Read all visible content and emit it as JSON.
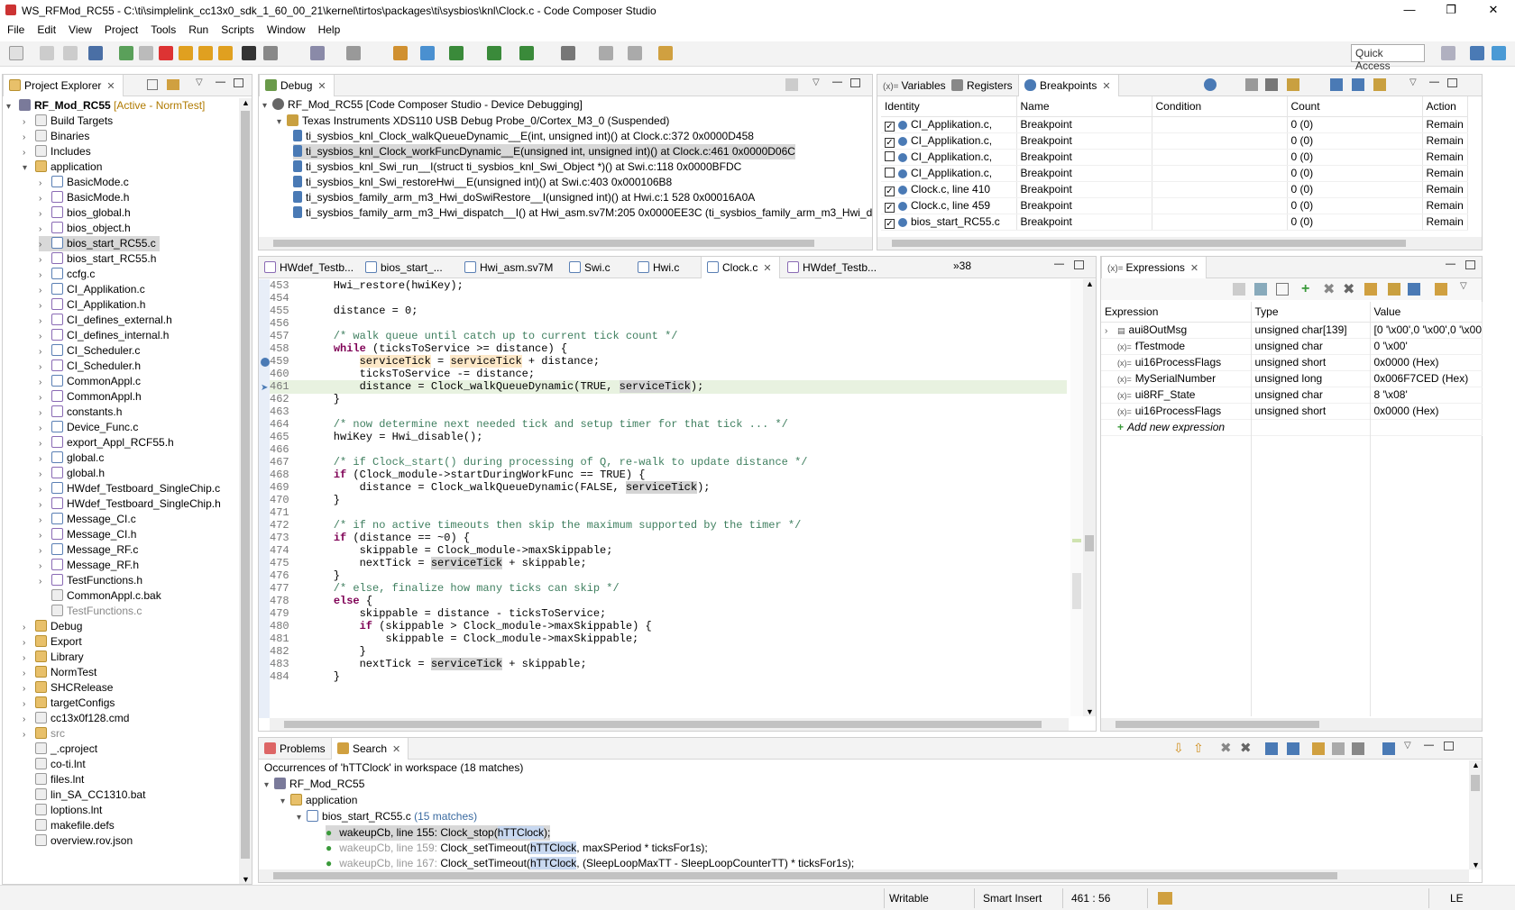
{
  "window": {
    "title": "WS_RFMod_RC55 - C:\\ti\\simplelink_cc13x0_sdk_1_60_00_21\\kernel\\tirtos\\packages\\ti\\sysbios\\knl\\Clock.c - Code Composer Studio"
  },
  "menu": [
    "File",
    "Edit",
    "View",
    "Project",
    "Tools",
    "Run",
    "Scripts",
    "Window",
    "Help"
  ],
  "quick_access": "Quick Access",
  "project_explorer": {
    "tab": "Project Explorer",
    "project": "RF_Mod_RC55",
    "project_status": "[Active - NormTest]",
    "items": [
      {
        "label": "Build Targets",
        "depth": 1,
        "kind": "target"
      },
      {
        "label": "Binaries",
        "depth": 1,
        "kind": "bin"
      },
      {
        "label": "Includes",
        "depth": 1,
        "kind": "inc"
      },
      {
        "label": "application",
        "depth": 1,
        "kind": "folder",
        "open": true
      },
      {
        "label": "BasicMode.c",
        "depth": 2,
        "kind": "c"
      },
      {
        "label": "BasicMode.h",
        "depth": 2,
        "kind": "h"
      },
      {
        "label": "bios_global.h",
        "depth": 2,
        "kind": "h"
      },
      {
        "label": "bios_object.h",
        "depth": 2,
        "kind": "h"
      },
      {
        "label": "bios_start_RC55.c",
        "depth": 2,
        "kind": "c",
        "selected": true
      },
      {
        "label": "bios_start_RC55.h",
        "depth": 2,
        "kind": "h"
      },
      {
        "label": "ccfg.c",
        "depth": 2,
        "kind": "c"
      },
      {
        "label": "CI_Applikation.c",
        "depth": 2,
        "kind": "c"
      },
      {
        "label": "CI_Applikation.h",
        "depth": 2,
        "kind": "h"
      },
      {
        "label": "CI_defines_external.h",
        "depth": 2,
        "kind": "h"
      },
      {
        "label": "CI_defines_internal.h",
        "depth": 2,
        "kind": "h"
      },
      {
        "label": "CI_Scheduler.c",
        "depth": 2,
        "kind": "c"
      },
      {
        "label": "CI_Scheduler.h",
        "depth": 2,
        "kind": "h"
      },
      {
        "label": "CommonAppl.c",
        "depth": 2,
        "kind": "c"
      },
      {
        "label": "CommonAppl.h",
        "depth": 2,
        "kind": "h"
      },
      {
        "label": "constants.h",
        "depth": 2,
        "kind": "h"
      },
      {
        "label": "Device_Func.c",
        "depth": 2,
        "kind": "c"
      },
      {
        "label": "export_Appl_RCF55.h",
        "depth": 2,
        "kind": "h"
      },
      {
        "label": "global.c",
        "depth": 2,
        "kind": "c"
      },
      {
        "label": "global.h",
        "depth": 2,
        "kind": "h"
      },
      {
        "label": "HWdef_Testboard_SingleChip.c",
        "depth": 2,
        "kind": "c"
      },
      {
        "label": "HWdef_Testboard_SingleChip.h",
        "depth": 2,
        "kind": "h"
      },
      {
        "label": "Message_CI.c",
        "depth": 2,
        "kind": "c"
      },
      {
        "label": "Message_CI.h",
        "depth": 2,
        "kind": "h"
      },
      {
        "label": "Message_RF.c",
        "depth": 2,
        "kind": "c"
      },
      {
        "label": "Message_RF.h",
        "depth": 2,
        "kind": "h"
      },
      {
        "label": "TestFunctions.h",
        "depth": 2,
        "kind": "h"
      },
      {
        "label": "CommonAppl.c.bak",
        "depth": 2,
        "kind": "file",
        "noarrow": true
      },
      {
        "label": "TestFunctions.c",
        "depth": 2,
        "kind": "file",
        "noarrow": true,
        "grey": true
      },
      {
        "label": "Debug",
        "depth": 1,
        "kind": "folder"
      },
      {
        "label": "Export",
        "depth": 1,
        "kind": "folder"
      },
      {
        "label": "Library",
        "depth": 1,
        "kind": "folder"
      },
      {
        "label": "NormTest",
        "depth": 1,
        "kind": "folder"
      },
      {
        "label": "SHCRelease",
        "depth": 1,
        "kind": "folder"
      },
      {
        "label": "targetConfigs",
        "depth": 1,
        "kind": "folder"
      },
      {
        "label": "cc13x0f128.cmd",
        "depth": 1,
        "kind": "file"
      },
      {
        "label": "src",
        "depth": 1,
        "kind": "folder",
        "grey": true
      },
      {
        "label": "_.cproject",
        "depth": 1,
        "kind": "file",
        "noarrow": true
      },
      {
        "label": "co-ti.lnt",
        "depth": 1,
        "kind": "file",
        "noarrow": true
      },
      {
        "label": "files.lnt",
        "depth": 1,
        "kind": "file",
        "noarrow": true
      },
      {
        "label": "lin_SA_CC1310.bat",
        "depth": 1,
        "kind": "file",
        "noarrow": true
      },
      {
        "label": "loptions.lnt",
        "depth": 1,
        "kind": "file",
        "noarrow": true
      },
      {
        "label": "makefile.defs",
        "depth": 1,
        "kind": "file",
        "noarrow": true
      },
      {
        "label": "overview.rov.json",
        "depth": 1,
        "kind": "file",
        "noarrow": true
      }
    ]
  },
  "debug": {
    "tab": "Debug",
    "session": "RF_Mod_RC55 [Code Composer Studio - Device Debugging]",
    "probe": "Texas Instruments XDS110 USB Debug Probe_0/Cortex_M3_0 (Suspended)",
    "frames": [
      "ti_sysbios_knl_Clock_walkQueueDynamic__E(int, unsigned int)() at Clock.c:372 0x0000D458",
      "ti_sysbios_knl_Clock_workFuncDynamic__E(unsigned int, unsigned int)() at Clock.c:461 0x0000D06C",
      "ti_sysbios_knl_Swi_run__I(struct ti_sysbios_knl_Swi_Object *)() at Swi.c:118 0x0000BFDC",
      "ti_sysbios_knl_Swi_restoreHwi__E(unsigned int)() at Swi.c:403 0x000106B8",
      "ti_sysbios_family_arm_m3_Hwi_doSwiRestore__I(unsigned int)() at Hwi.c:1 528 0x00016A0A",
      "ti_sysbios_family_arm_m3_Hwi_dispatch__I() at Hwi_asm.sv7M:205 0x0000EE3C  (ti_sysbios_family_arm_m3_Hwi_d"
    ]
  },
  "breakpoints": {
    "tabs": [
      "Variables",
      "Registers",
      "Breakpoints"
    ],
    "headers": [
      "Identity",
      "Name",
      "Condition",
      "Count",
      "Action"
    ],
    "rows": [
      {
        "identity": "CI_Applikation.c,",
        "name": "Breakpoint",
        "condition": "",
        "count": "0 (0)",
        "action": "Remain Hal",
        "checked": true
      },
      {
        "identity": "CI_Applikation.c,",
        "name": "Breakpoint",
        "condition": "",
        "count": "0 (0)",
        "action": "Remain Hal",
        "checked": true
      },
      {
        "identity": "CI_Applikation.c,",
        "name": "Breakpoint",
        "condition": "",
        "count": "0 (0)",
        "action": "Remain Hal",
        "checked": false
      },
      {
        "identity": "CI_Applikation.c,",
        "name": "Breakpoint",
        "condition": "",
        "count": "0 (0)",
        "action": "Remain Hal",
        "checked": false
      },
      {
        "identity": "Clock.c, line 410",
        "name": "Breakpoint",
        "condition": "",
        "count": "0 (0)",
        "action": "Remain Hal",
        "checked": true
      },
      {
        "identity": "Clock.c, line 459",
        "name": "Breakpoint",
        "condition": "",
        "count": "0 (0)",
        "action": "Remain Hal",
        "checked": true
      },
      {
        "identity": "bios_start_RC55.c",
        "name": "Breakpoint",
        "condition": "",
        "count": "0 (0)",
        "action": "Remain Hal",
        "checked": true
      }
    ]
  },
  "editor": {
    "tabs": [
      "HWdef_Testb...",
      "bios_start_...",
      "Hwi_asm.sv7M",
      "Swi.c",
      "Hwi.c",
      "Clock.c",
      "HWdef_Testb..."
    ],
    "overflow": "»38",
    "active_tab": 5,
    "lines": [
      {
        "n": "453",
        "t": "    Hwi_restore(hwiKey);"
      },
      {
        "n": "454",
        "t": ""
      },
      {
        "n": "455",
        "t": "    distance = 0;"
      },
      {
        "n": "456",
        "t": ""
      },
      {
        "n": "457",
        "t": "    /* walk queue until catch up to current tick count */",
        "c": true
      },
      {
        "n": "458",
        "t": "    while (ticksToService >= distance) {",
        "kw": "while"
      },
      {
        "n": "459",
        "t": "        serviceTick = serviceTick + distance;",
        "bp": true
      },
      {
        "n": "460",
        "t": "        ticksToService -= distance;"
      },
      {
        "n": "461",
        "t": "        distance = Clock_walkQueueDynamic(TRUE, serviceTick);",
        "cur": true
      },
      {
        "n": "462",
        "t": "    }"
      },
      {
        "n": "463",
        "t": ""
      },
      {
        "n": "464",
        "t": "    /* now determine next needed tick and setup timer for that tick ... */",
        "c": true
      },
      {
        "n": "465",
        "t": "    hwiKey = Hwi_disable();"
      },
      {
        "n": "466",
        "t": ""
      },
      {
        "n": "467",
        "t": "    /* if Clock_start() during processing of Q, re-walk to update distance */",
        "c": true
      },
      {
        "n": "468",
        "t": "    if (Clock_module->startDuringWorkFunc == TRUE) {",
        "kw": "if"
      },
      {
        "n": "469",
        "t": "        distance = Clock_walkQueueDynamic(FALSE, serviceTick);"
      },
      {
        "n": "470",
        "t": "    }"
      },
      {
        "n": "471",
        "t": ""
      },
      {
        "n": "472",
        "t": "    /* if no active timeouts then skip the maximum supported by the timer */",
        "c": true
      },
      {
        "n": "473",
        "t": "    if (distance == ~0) {",
        "kw": "if"
      },
      {
        "n": "474",
        "t": "        skippable = Clock_module->maxSkippable;"
      },
      {
        "n": "475",
        "t": "        nextTick = serviceTick + skippable;"
      },
      {
        "n": "476",
        "t": "    }"
      },
      {
        "n": "477",
        "t": "    /* else, finalize how many ticks can skip */",
        "c": true
      },
      {
        "n": "478",
        "t": "    else {",
        "kw": "else"
      },
      {
        "n": "479",
        "t": "        skippable = distance - ticksToService;"
      },
      {
        "n": "480",
        "t": "        if (skippable > Clock_module->maxSkippable) {",
        "kw": "if"
      },
      {
        "n": "481",
        "t": "            skippable = Clock_module->maxSkippable;"
      },
      {
        "n": "482",
        "t": "        }"
      },
      {
        "n": "483",
        "t": "        nextTick = serviceTick + skippable;"
      },
      {
        "n": "484",
        "t": "    }"
      }
    ]
  },
  "expressions": {
    "tab": "Expressions",
    "headers": [
      "Expression",
      "Type",
      "Value"
    ],
    "rows": [
      {
        "name": "aui8OutMsg",
        "type": "unsigned char[139]",
        "value": "[0 '\\x00',0 '\\x00',0 '\\x00"
      },
      {
        "name": "fTestmode",
        "type": "unsigned char",
        "value": "0 '\\x00'"
      },
      {
        "name": "ui16ProcessFlags",
        "type": "unsigned short",
        "value": "0x0000 (Hex)"
      },
      {
        "name": "MySerialNumber",
        "type": "unsigned long",
        "value": "0x006F7CED (Hex)"
      },
      {
        "name": "ui8RF_State",
        "type": "unsigned char",
        "value": "8 '\\x08'"
      },
      {
        "name": "ui16ProcessFlags",
        "type": "unsigned short",
        "value": "0x0000 (Hex)"
      }
    ],
    "add_new": "Add new expression"
  },
  "search": {
    "tabs": [
      "Problems",
      "Search"
    ],
    "summary": "Occurrences of 'hTTClock' in workspace (18 matches)",
    "project": "RF_Mod_RC55",
    "folder": "application",
    "file": "bios_start_RC55.c",
    "file_matches": "(15 matches)",
    "results": [
      {
        "loc": "wakeupCb, line 155:",
        "pre": "Clock_stop(",
        "match": "hTTClock",
        "post": ");"
      },
      {
        "loc": "wakeupCb, line 159:",
        "pre": "Clock_setTimeout(",
        "match": "hTTClock",
        "post": ", maxSPeriod * ticksFor1s);"
      },
      {
        "loc": "wakeupCb, line 167:",
        "pre": "Clock_setTimeout(",
        "match": "hTTClock",
        "post": ", (SleepLoopMaxTT - SleepLoopCounterTT) * ticksFor1s);"
      }
    ]
  },
  "status": {
    "writable": "Writable",
    "insert": "Smart Insert",
    "position": "461 : 56",
    "encoding": "LE"
  }
}
